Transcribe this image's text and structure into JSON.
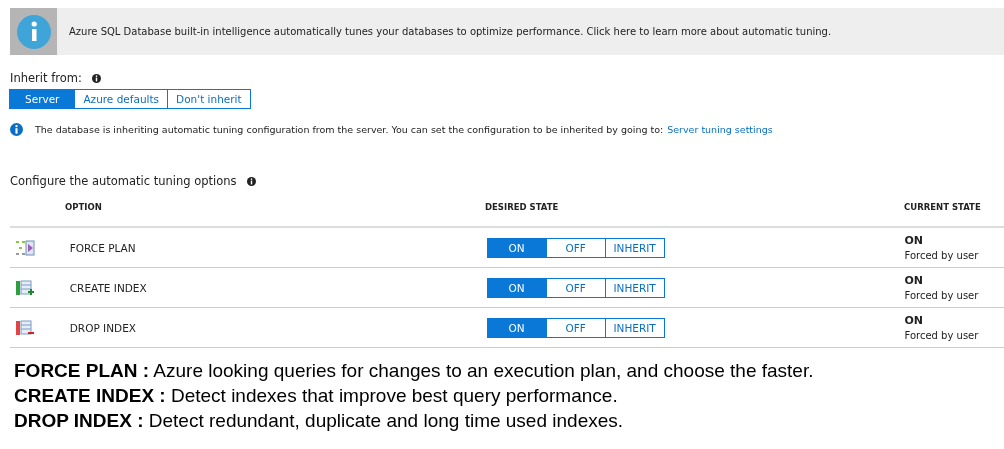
{
  "banner": {
    "text": "Azure SQL Database built-in intelligence automatically tunes your databases to optimize performance. Click here to learn more about automatic tuning."
  },
  "inherit": {
    "label": "Inherit from:",
    "options": [
      {
        "label": "Server",
        "selected": true
      },
      {
        "label": "Azure defaults",
        "selected": false
      },
      {
        "label": "Don't inherit",
        "selected": false
      }
    ]
  },
  "info": {
    "text": "The database is inheriting automatic tuning configuration from the server. You can set the configuration to be inherited by going to:",
    "link": "Server tuning settings"
  },
  "section_title": "Configure the automatic tuning options",
  "table": {
    "columns": [
      "OPTION",
      "DESIRED STATE",
      "CURRENT STATE"
    ],
    "rows": [
      {
        "kind": "force-plan",
        "option": "FORCE PLAN",
        "desired": [
          {
            "label": "ON",
            "selected": true
          },
          {
            "label": "OFF",
            "selected": false
          },
          {
            "label": "INHERIT",
            "selected": false
          }
        ],
        "current": "ON",
        "current_note": "Forced by user"
      },
      {
        "kind": "create-index",
        "option": "CREATE INDEX",
        "desired": [
          {
            "label": "ON",
            "selected": true
          },
          {
            "label": "OFF",
            "selected": false
          },
          {
            "label": "INHERIT",
            "selected": false
          }
        ],
        "current": "ON",
        "current_note": "Forced by user"
      },
      {
        "kind": "drop-index",
        "option": "DROP INDEX",
        "desired": [
          {
            "label": "ON",
            "selected": true
          },
          {
            "label": "OFF",
            "selected": false
          },
          {
            "label": "INHERIT",
            "selected": false
          }
        ],
        "current": "ON",
        "current_note": "Forced by user"
      }
    ]
  },
  "notes": [
    "**FORCE PLAN :** Azure looking queries for changes to an execution plan, and choose the faster.",
    "**CREATE INDEX :** Detect indexes that improve best query performance.",
    "**DROP INDEX :** Detect redundant, duplicate and long time used indexes."
  ]
}
